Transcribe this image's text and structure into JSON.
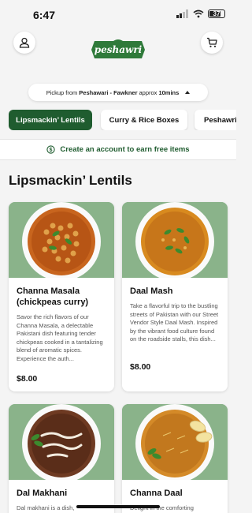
{
  "status": {
    "time": "6:47",
    "battery": "37"
  },
  "header": {
    "logo_text": "peshawri",
    "profile_icon": "user-icon",
    "cart_icon": "cart-icon"
  },
  "pickup": {
    "prefix": "Pickup from",
    "location": "Peshawari - Fawkner",
    "eta_prefix": "approx",
    "eta": "10mins"
  },
  "tabs": [
    {
      "label": "Lipsmackin’ Lentils",
      "active": true
    },
    {
      "label": "Curry & Rice Boxes",
      "active": false
    },
    {
      "label": "Peshawri",
      "active": false
    }
  ],
  "promo": {
    "text": "Create an account to earn free items",
    "icon": "dollar-circle-icon"
  },
  "section": {
    "title": "Lipsmackin’ Lentils"
  },
  "items": [
    {
      "name": "Channa Masala (chickpeas curry)",
      "description": "Savor the rich flavors of our Channa Masala, a delectable Pakistani dish featuring tender chickpeas cooked in a tantalizing blend of aromatic spices. Experience the auth...",
      "price": "$8.00"
    },
    {
      "name": "Daal Mash",
      "description": "Take a flavorful trip to the bustling streets of Pakistan with our Street Vendor Style Daal Mash. Inspired by the vibrant food culture found on the roadside stalls, this dish...",
      "price": "$8.00"
    },
    {
      "name": "Dal Makhani",
      "description": "Dal makhani is a dish,",
      "price": ""
    },
    {
      "name": "Channa Daal",
      "description": "Delight in the comforting",
      "price": ""
    }
  ],
  "colors": {
    "brand_green": "#1f5c2f",
    "card_bg_green": "#8ab38a",
    "page_bg": "#f4f4f4"
  }
}
